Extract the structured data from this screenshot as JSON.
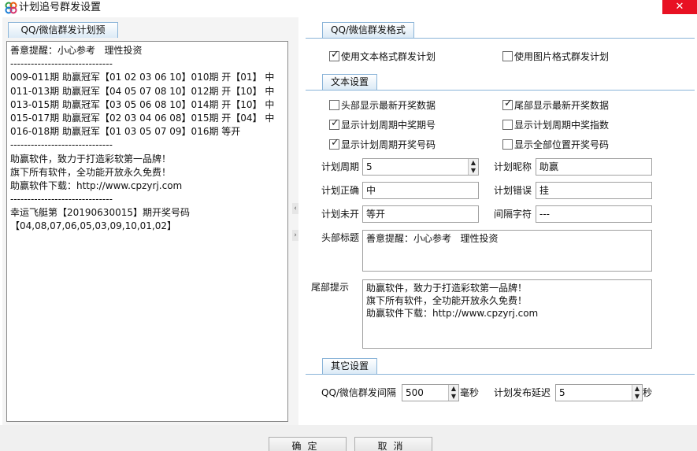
{
  "window": {
    "title": "计划追号群发设置",
    "close_glyph": "✕"
  },
  "preview": {
    "tab_label": "QQ/微信群发计划预",
    "lines": [
      "善意提醒：小心参考   理性投资",
      "------------------------------",
      "009-011期 助赢冠军【01 02 03 06 10】010期 开【01】 中",
      "011-013期 助赢冠军【04 05 07 08 10】012期 开【10】 中",
      "013-015期 助赢冠军【03 05 06 08 10】014期 开【10】 中",
      "015-017期 助赢冠军【02 03 04 06 08】015期 开【04】 中",
      "016-018期 助赢冠军【01 03 05 07 09】016期 等开",
      "------------------------------",
      "助赢软件，致力于打造彩软第一品牌！",
      "旗下所有软件，全功能开放永久免费！",
      "助赢软件下载：http://www.cpzyrj.com",
      "------------------------------",
      "幸运飞艇第【20190630015】期开奖号码",
      "【04,08,07,06,05,03,09,10,01,02】"
    ]
  },
  "splitter": {
    "left_arrow": "‹",
    "right_arrow": "›"
  },
  "format": {
    "tab_label": "QQ/微信群发格式",
    "text_plan": {
      "label": "使用文本格式群发计划",
      "checked": true
    },
    "image_plan": {
      "label": "使用图片格式群发计划",
      "checked": false
    }
  },
  "text_settings": {
    "tab_label": "文本设置",
    "options": [
      {
        "label": "头部显示最新开奖数据",
        "checked": false
      },
      {
        "label": "尾部显示最新开奖数据",
        "checked": true
      },
      {
        "label": "显示计划周期中奖期号",
        "checked": true
      },
      {
        "label": "显示计划周期中奖指数",
        "checked": false
      },
      {
        "label": "显示计划周期开奖号码",
        "checked": true
      },
      {
        "label": "显示全部位置开奖号码",
        "checked": false
      }
    ],
    "check_glyph": "✓",
    "plan_cycle": {
      "label": "计划周期",
      "value": "5"
    },
    "plan_nickname": {
      "label": "计划昵称",
      "value": "助赢"
    },
    "plan_correct": {
      "label": "计划正确",
      "value": "中"
    },
    "plan_wrong": {
      "label": "计划错误",
      "value": "挂"
    },
    "plan_pending": {
      "label": "计划未开",
      "value": "等开"
    },
    "separator_char": {
      "label": "间隔字符",
      "value": "---"
    },
    "header_title": {
      "label": "头部标题",
      "lines": [
        "善意提醒：小心参考   理性投资"
      ]
    },
    "footer_tip": {
      "label": "尾部提示",
      "lines": [
        "助赢软件，致力于打造彩软第一品牌！",
        "旗下所有软件，全功能开放永久免费！",
        "助赢软件下载：http://www.cpzyrj.com"
      ]
    },
    "spin_up": "▲",
    "spin_down": "▼"
  },
  "other_settings": {
    "tab_label": "其它设置",
    "send_interval": {
      "label": "QQ/微信群发间隔",
      "value": "500",
      "unit": "毫秒"
    },
    "publish_delay": {
      "label": "计划发布延迟",
      "value": "5",
      "unit": "秒"
    }
  },
  "buttons": {
    "ok": "确定",
    "cancel": "取消"
  },
  "colors": {
    "tab_border": "#8ab4d8",
    "close_button": "#e81123",
    "panel_bg": "#f4f4f4"
  }
}
